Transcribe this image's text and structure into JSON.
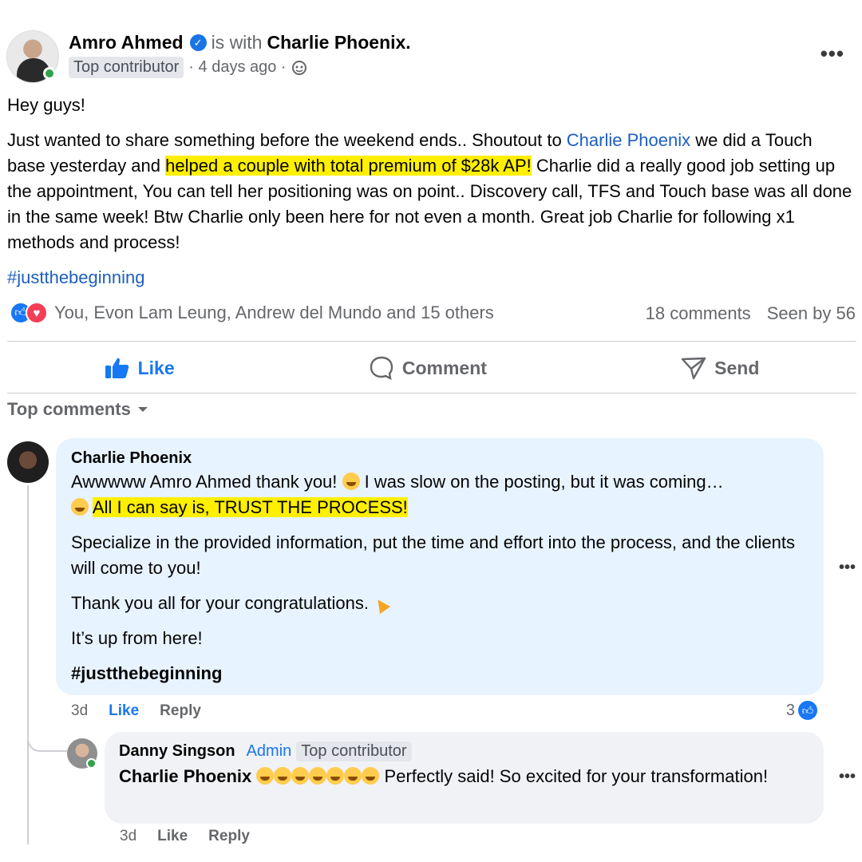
{
  "post": {
    "author": "Amro Ahmed",
    "with_text": "is with",
    "tagged": "Charlie Phoenix.",
    "badge": "Top contributor",
    "time": "· 4 days ago ·",
    "greeting": "Hey guys!",
    "body_1": "Just wanted to share something before the weekend ends.. Shoutout to ",
    "mention": "Charlie Phoenix",
    "body_2": " we did a Touch base yesterday and ",
    "highlight": "helped a couple with total premium of $28k AP!",
    "body_3": " Charlie did a really good job setting up the appointment, You can tell her  positioning was on point.. Discovery call, TFS and Touch base was all done in the same week! Btw Charlie only been here for not even a month. Great job Charlie for following x1 methods and process!",
    "hashtag": "#justthebeginning",
    "reactors": "You, Evon Lam Leung, Andrew del Mundo and 15 others",
    "comments_count": "18 comments",
    "seen_by": "Seen by 56"
  },
  "actions": {
    "like": "Like",
    "comment": "Comment",
    "send": "Send"
  },
  "top_comments_label": "Top comments",
  "comment1": {
    "name": "Charlie Phoenix",
    "line1": "Awwwww Amro Ahmed thank you! ",
    "line1b": " I was slow on the posting, but it was coming…",
    "highlight": "All I can say is, TRUST THE PROCESS!",
    "para2": "Specialize in the provided information, put the time and effort into the process, and the clients will come to you!",
    "para3": "Thank you all for your congratulations. ",
    "para4": "It’s up from here!",
    "hashtag": "#justthebeginning",
    "time": "3d",
    "like": "Like",
    "reply": "Reply",
    "reaction_count": "3"
  },
  "reply1": {
    "name": "Danny Singson",
    "role": "Admin",
    "badge": "Top contributor",
    "mention": "Charlie Phoenix",
    "text": " Perfectly said! So excited for your transformation!",
    "time": "3d",
    "like": "Like",
    "reply": "Reply"
  },
  "colors": {
    "accent": "#1877f2",
    "link": "#1d5fbf",
    "highlight": "#ffef00",
    "comment_bubble": "#e7f3ff",
    "reply_bubble": "#f0f2f5"
  }
}
